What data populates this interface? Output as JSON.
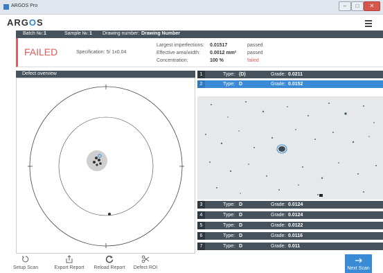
{
  "window": {
    "title": "ARGOS Pro"
  },
  "app": {
    "logo_prefix": "ARG",
    "logo_o": "O",
    "logo_suffix": "S"
  },
  "batch": {
    "batch_label": "Batch №:",
    "batch_value": "1",
    "sample_label": "Sample №:",
    "sample_value": "1",
    "drawing_label": "Drawing number:",
    "drawing_value": "Drawing Number"
  },
  "result": {
    "status": "FAILED",
    "specification": "Specification: 5/ 1x0.04",
    "metrics": [
      {
        "label": "Largest imperfections:",
        "value": "0.01517",
        "status": "passed"
      },
      {
        "label": "Effective area/width:",
        "value": "0.0012 mm²",
        "status": "passed"
      },
      {
        "label": "Concentration:",
        "value": "100 %",
        "status": "failed"
      }
    ]
  },
  "overview": {
    "title": "Defect overview"
  },
  "defects": [
    {
      "num": "1",
      "type_label": "Type:",
      "type": "(D)",
      "grade_label": "Grade:",
      "grade": "0.0211"
    },
    {
      "num": "2",
      "type_label": "Type:",
      "type": "D",
      "grade_label": "Grade:",
      "grade": "0.0152"
    },
    {
      "num": "3",
      "type_label": "Type:",
      "type": "D",
      "grade_label": "Grade:",
      "grade": "0.0124"
    },
    {
      "num": "4",
      "type_label": "Type:",
      "type": "D",
      "grade_label": "Grade:",
      "grade": "0.0124"
    },
    {
      "num": "5",
      "type_label": "Type:",
      "type": "D",
      "grade_label": "Grade:",
      "grade": "0.0122"
    },
    {
      "num": "6",
      "type_label": "Type:",
      "type": "D",
      "grade_label": "Grade:",
      "grade": "0.0116"
    },
    {
      "num": "7",
      "type_label": "Type:",
      "type": "D",
      "grade_label": "Grade:",
      "grade": "0.011"
    }
  ],
  "footer": {
    "setup_scan": "Setup Scan",
    "export_report": "Export Report",
    "reload_report": "Reload Report",
    "defect_roi": "Defect ROI",
    "next_scan": "Next Scan"
  },
  "colors": {
    "accent": "#3a8ad6",
    "failed": "#e05a5a",
    "header_bar": "#46525c"
  }
}
